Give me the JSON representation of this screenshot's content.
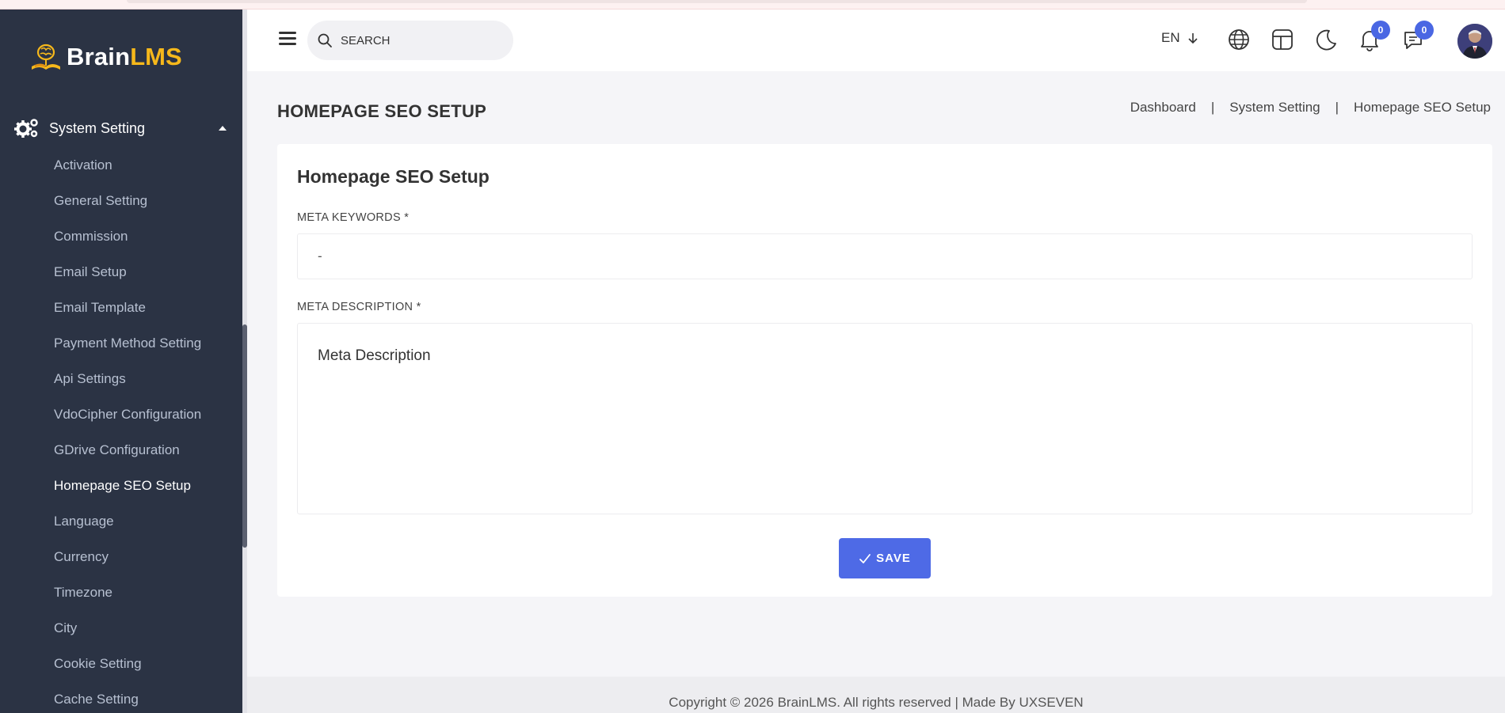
{
  "app": {
    "brand_part1": "Brain",
    "brand_part2": "LMS"
  },
  "sidebar": {
    "group_label": "System Setting",
    "items": [
      {
        "label": "Activation"
      },
      {
        "label": "General Setting"
      },
      {
        "label": "Commission"
      },
      {
        "label": "Email Setup"
      },
      {
        "label": "Email Template"
      },
      {
        "label": "Payment Method Setting"
      },
      {
        "label": "Api Settings"
      },
      {
        "label": "VdoCipher Configuration"
      },
      {
        "label": "GDrive Configuration"
      },
      {
        "label": "Homepage SEO Setup",
        "active": true
      },
      {
        "label": "Language"
      },
      {
        "label": "Currency"
      },
      {
        "label": "Timezone"
      },
      {
        "label": "City"
      },
      {
        "label": "Cookie Setting"
      },
      {
        "label": "Cache Setting"
      }
    ]
  },
  "header": {
    "search_placeholder": "SEARCH",
    "language": "EN",
    "notifications_count": "0",
    "messages_count": "0"
  },
  "page": {
    "title": "HOMEPAGE SEO SETUP",
    "breadcrumb": [
      "Dashboard",
      "System Setting",
      "Homepage SEO Setup"
    ],
    "breadcrumb_separator": "|"
  },
  "form": {
    "card_title": "Homepage SEO Setup",
    "meta_keywords_label": "META KEYWORDS *",
    "meta_keywords_value": "-",
    "meta_description_label": "META DESCRIPTION *",
    "meta_description_value": "Meta Description",
    "save_label": "SAVE"
  },
  "footer": {
    "text": "Copyright © 2026 BrainLMS. All rights reserved | Made By UXSEVEN"
  },
  "colors": {
    "sidebar_bg": "#2b3344",
    "accent": "#4e6ae6",
    "brand_yellow": "#f6b81b"
  }
}
